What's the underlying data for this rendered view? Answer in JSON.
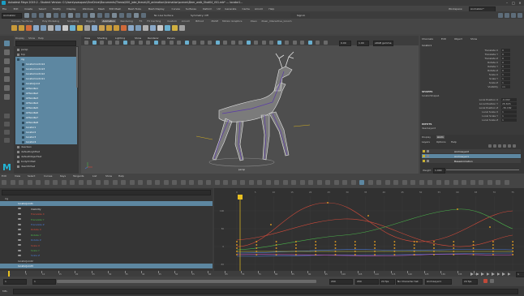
{
  "titlebar": {
    "app_label": "Autodesk Maya 2019.2 - Student Version: C:\\Users\\ovasquez\\OneDrive\\Documents\\Thesis\\000_jake_thesis\\05_animation\\Animation\\scenes\\Deer_walk_Shot04_V01.mb* --- locator1..."
  },
  "menubar": {
    "items": [
      "File",
      "Edit",
      "Create",
      "Select",
      "Modify",
      "Display",
      "Windows",
      "Mesh",
      "Edit Mesh",
      "Mesh Tools",
      "Mesh Display",
      "Curves",
      "Surfaces",
      "Deform",
      "UV",
      "Generate",
      "Cache",
      "Arnold",
      "Help"
    ],
    "workspace_label": "Workspace:",
    "workspace_value": "Animation*"
  },
  "statusline": {
    "mode": "Animation",
    "no_live_surface": "No Live Surface",
    "symmetry": "Symmetry: Off",
    "signin": "Sign In"
  },
  "shelf_tabs": [
    "Curves / Surfaces",
    "Poly Modeling",
    "Sculpting",
    "Rigging",
    "Animation",
    "Rendering",
    "FX",
    "FX Caching",
    "Custom",
    "Arnold",
    "Bifrost",
    "MASH",
    "Motion Graphics",
    "XGen",
    "XGen_Interactive_Groom"
  ],
  "outliner": {
    "menus": [
      "Display",
      "Show",
      "Help"
    ],
    "search_placeholder": "Search...",
    "items": [
      {
        "label": "persp",
        "depth": 0,
        "selected": false
      },
      {
        "label": "top",
        "depth": 0,
        "selected": false
      },
      {
        "label": "rig",
        "depth": 0,
        "selected": true
      },
      {
        "label": "locatorControl4",
        "depth": 1,
        "selected": true
      },
      {
        "label": "locatorControl3",
        "depth": 1,
        "selected": true
      },
      {
        "label": "locatorControl2",
        "depth": 1,
        "selected": true
      },
      {
        "label": "locatorControl1",
        "depth": 1,
        "selected": true
      },
      {
        "label": "locatorJoint",
        "depth": 1,
        "selected": true
      },
      {
        "label": "ikHandle1",
        "depth": 1,
        "selected": true
      },
      {
        "label": "ikHandle2",
        "depth": 1,
        "selected": true
      },
      {
        "label": "ikHandle3",
        "depth": 1,
        "selected": true
      },
      {
        "label": "ikHandle4",
        "depth": 1,
        "selected": true
      },
      {
        "label": "ikHandle5",
        "depth": 1,
        "selected": true
      },
      {
        "label": "ikHandle6",
        "depth": 1,
        "selected": true
      },
      {
        "label": "ikHandle7",
        "depth": 1,
        "selected": true
      },
      {
        "label": "ikHandle8",
        "depth": 1,
        "selected": true
      },
      {
        "label": "locator1",
        "depth": 1,
        "selected": true
      },
      {
        "label": "locator2",
        "depth": 1,
        "selected": true
      },
      {
        "label": "locator3",
        "depth": 1,
        "selected": true
      },
      {
        "label": "locator4",
        "depth": 1,
        "selected": true
      },
      {
        "label": "deerGeo",
        "depth": 0,
        "selected": false
      },
      {
        "label": "defaultLightSet",
        "depth": 0,
        "selected": false
      },
      {
        "label": "defaultObjectSet",
        "depth": 0,
        "selected": false
      },
      {
        "label": "bodyCtrlSet",
        "depth": 0,
        "selected": false
      },
      {
        "label": "deerCtrlSet",
        "depth": 0,
        "selected": false
      }
    ]
  },
  "viewport": {
    "menus": [
      "View",
      "Shading",
      "Lighting",
      "Show",
      "Renderer",
      "Panels"
    ],
    "camera_label": "persp",
    "stats": "",
    "exposure": "0.00",
    "gamma": "1.00",
    "color_space": "sRGB gamma"
  },
  "channelbox": {
    "menus": [
      "Channels",
      "Edit",
      "Object",
      "Show"
    ],
    "object": "locator1",
    "channels": [
      {
        "name": "Translate X",
        "value": "0"
      },
      {
        "name": "Translate Y",
        "value": "0"
      },
      {
        "name": "Translate Z",
        "value": "0"
      },
      {
        "name": "Rotate X",
        "value": "0"
      },
      {
        "name": "Rotate Y",
        "value": "0"
      },
      {
        "name": "Rotate Z",
        "value": "0"
      },
      {
        "name": "Scale X",
        "value": "1"
      },
      {
        "name": "Scale Y",
        "value": "1"
      },
      {
        "name": "Scale Z",
        "value": "1"
      },
      {
        "name": "Visibility",
        "value": "on"
      }
    ],
    "shapes_label": "SHAPES",
    "shape_name": "locatorShape1",
    "shape_channels": [
      {
        "name": "Local Position X",
        "value": "-6.002"
      },
      {
        "name": "Local Position Y",
        "value": "26.626"
      },
      {
        "name": "Local Position Z",
        "value": "-36.182"
      },
      {
        "name": "Local Scale X",
        "value": "1"
      },
      {
        "name": "Local Scale Y",
        "value": "1"
      },
      {
        "name": "Local Scale Z",
        "value": "1"
      }
    ],
    "inputs_label": "INPUTS",
    "input_name": "deerLayer2"
  },
  "layers": {
    "tabs": [
      "Display",
      "Anim"
    ],
    "menus": [
      "Layers",
      "Options",
      "Help"
    ],
    "items": [
      {
        "label": "AnimLayer2",
        "active": false
      },
      {
        "label": "AnimLayer1",
        "active": true
      },
      {
        "label": "BaseAnimation",
        "active": false
      }
    ],
    "weight_label": "Weight",
    "weight_value": "1.000"
  },
  "graph_editor": {
    "menus": [
      "Edit",
      "View",
      "Select",
      "Curves",
      "Keys",
      "Tangents",
      "List",
      "Show",
      "Help"
    ],
    "search_placeholder": "Search...",
    "list": [
      {
        "label": "rig",
        "depth": 0,
        "kind": "group"
      },
      {
        "label": "locatorJoint1",
        "depth": 1,
        "kind": "selected"
      },
      {
        "label": "Visibility",
        "depth": 2,
        "kind": "white"
      },
      {
        "label": "Translate X",
        "depth": 2,
        "kind": "red"
      },
      {
        "label": "Translate Y",
        "depth": 2,
        "kind": "green"
      },
      {
        "label": "Translate Z",
        "depth": 2,
        "kind": "blue"
      },
      {
        "label": "Rotate X",
        "depth": 2,
        "kind": "red"
      },
      {
        "label": "Rotate Y",
        "depth": 2,
        "kind": "green"
      },
      {
        "label": "Rotate Z",
        "depth": 2,
        "kind": "blue"
      },
      {
        "label": "Scale X",
        "depth": 2,
        "kind": "red"
      },
      {
        "label": "Scale Y",
        "depth": 2,
        "kind": "green"
      },
      {
        "label": "Scale Z",
        "depth": 2,
        "kind": "blue"
      },
      {
        "label": "locatorJoint2",
        "depth": 1,
        "kind": "group"
      },
      {
        "label": "locatorJoint3",
        "depth": 1,
        "kind": "selected"
      }
    ],
    "stats_field": "",
    "y_ticks": [
      "100",
      "50",
      "0",
      "-50"
    ],
    "frame_ticks": [
      "0",
      "5",
      "10",
      "15",
      "20",
      "25",
      "30",
      "35",
      "40",
      "45",
      "50",
      "55",
      "60",
      "65",
      "70",
      "75"
    ]
  },
  "timeline": {
    "start": "1",
    "start_inner": "1",
    "end_inner": "200",
    "end": "200",
    "fps": "24 fps",
    "current_frame": "1",
    "character": "No Character Set",
    "anim_layer": "AnimLayer1",
    "sound": "24 fps",
    "range_ticks": [
      "1",
      "5",
      "10",
      "15",
      "20",
      "25",
      "30",
      "35",
      "40",
      "45",
      "50",
      "55",
      "60",
      "65",
      "70",
      "75",
      "80",
      "85",
      "90",
      "95",
      "100",
      "105",
      "110",
      "115",
      "120",
      "125",
      "130",
      "135",
      "140"
    ]
  },
  "command_line": {
    "mode": "MEL",
    "feedback": ""
  },
  "colors": {
    "selection": "#5d87a1",
    "curve_red": "#d04a3a",
    "curve_green": "#4ab04a",
    "curve_blue": "#4a7ad0",
    "key_orange": "#e8a021",
    "playhead": "#e8c021"
  }
}
